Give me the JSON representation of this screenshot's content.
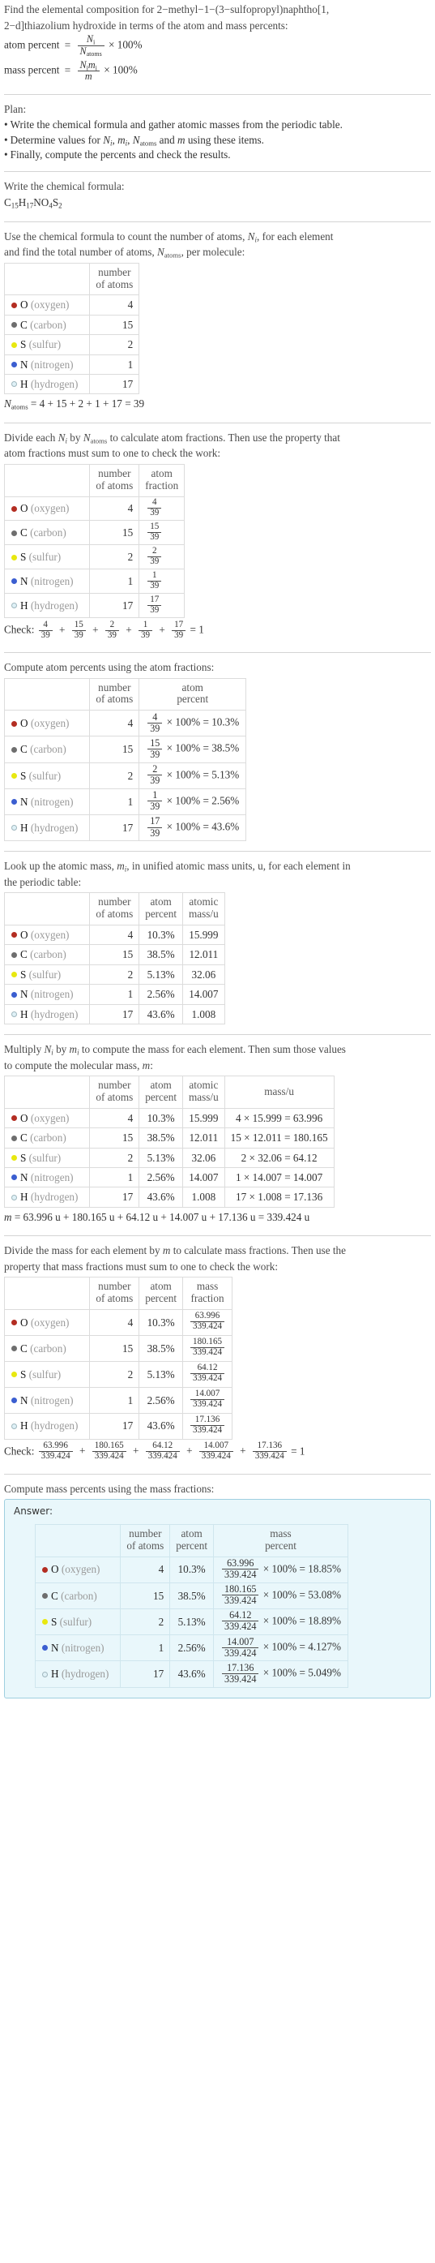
{
  "header": {
    "question_line1": "Find the elemental composition for 2−methyl−1−(3−sulfopropyl)naphtho[1,",
    "question_line2": "2−d]thiazolium hydroxide in terms of the atom and mass percents:",
    "atom_percent_label": "atom percent",
    "mass_percent_label": "mass percent",
    "percent_100": "× 100%",
    "equals": "=",
    "Ni": "N",
    "Ni_sub": "i",
    "Natoms": "N",
    "Natoms_sub": "atoms",
    "mi": "m",
    "mi_sub": "i",
    "m": "m"
  },
  "plan": {
    "title": "Plan:",
    "bullets": [
      "Write the chemical formula and gather atomic masses from the periodic table.",
      "Determine values for N_i, m_i, N_atoms and m using these items.",
      "Finally, compute the percents and check the results."
    ],
    "bullet1": "Write the chemical formula and gather atomic masses from the periodic table.",
    "bullet2_pre": "Determine values for",
    "bullet2_mid": "and",
    "bullet2_post": "using these items.",
    "bullet3": "Finally, compute the percents and check the results."
  },
  "formula_section": {
    "instruction": "Write the chemical formula:",
    "formula_parts": [
      {
        "sym": "C",
        "sub": "15"
      },
      {
        "sym": "H",
        "sub": "17"
      },
      {
        "sym": "N",
        "sub": ""
      },
      {
        "sym": "O",
        "sub": "4"
      },
      {
        "sym": "S",
        "sub": "2"
      }
    ],
    "formula_plain": "C15H17NO4S2"
  },
  "elements": [
    {
      "symbol": "O",
      "name": "(oxygen)",
      "color": "#b32d22",
      "hollow": false,
      "count": "4",
      "atom_fraction_num": "4",
      "atom_fraction_den": "39",
      "atom_percent": "10.3%",
      "atomic_mass": "15.999",
      "mass_expr": "4 × 15.999 = 63.996",
      "mass_product": "63.996",
      "mass_percent": "18.85%"
    },
    {
      "symbol": "C",
      "name": "(carbon)",
      "color": "#6e6e6e",
      "hollow": false,
      "count": "15",
      "atom_fraction_num": "15",
      "atom_fraction_den": "39",
      "atom_percent": "38.5%",
      "atomic_mass": "12.011",
      "mass_expr": "15 × 12.011 = 180.165",
      "mass_product": "180.165",
      "mass_percent": "53.08%"
    },
    {
      "symbol": "S",
      "name": "(sulfur)",
      "color": "#e8e80f",
      "hollow": false,
      "count": "2",
      "atom_fraction_num": "2",
      "atom_fraction_den": "39",
      "atom_percent": "5.13%",
      "atomic_mass": "32.06",
      "mass_expr": "2 × 32.06 = 64.12",
      "mass_product": "64.12",
      "mass_percent": "18.89%"
    },
    {
      "symbol": "N",
      "name": "(nitrogen)",
      "color": "#3b5ed0",
      "hollow": false,
      "count": "1",
      "atom_fraction_num": "1",
      "atom_fraction_den": "39",
      "atom_percent": "2.56%",
      "atomic_mass": "14.007",
      "mass_expr": "1 × 14.007 = 14.007",
      "mass_product": "14.007",
      "mass_percent": "4.127%"
    },
    {
      "symbol": "H",
      "name": "(hydrogen)",
      "color": "#dff1f7",
      "hollow": true,
      "count": "17",
      "atom_fraction_num": "17",
      "atom_fraction_den": "39",
      "atom_percent": "43.6%",
      "atomic_mass": "1.008",
      "mass_expr": "17 × 1.008 = 17.136",
      "mass_product": "17.136",
      "mass_percent": "5.049%"
    }
  ],
  "count_section": {
    "instruction_line1": "Use the chemical formula to count the number of atoms, N_i, for each element",
    "instruction_line2": "and find the total number of atoms, N_atoms, per molecule:",
    "col_number_of_atoms_l1": "number",
    "col_number_of_atoms_l2": "of atoms",
    "total_expr": "= 4 + 15 + 2 + 1 + 17 = 39",
    "total_value": "39"
  },
  "fraction_section": {
    "instruction_line1": "Divide each N_i by N_atoms to calculate atom fractions. Then use the property that",
    "instruction_line2": "atom fractions must sum to one to check the work:",
    "col_atom_fraction_l1": "atom",
    "col_atom_fraction_l2": "fraction",
    "check_label": "Check:",
    "check_result": "= 1",
    "denominator": "39"
  },
  "atom_percent_section": {
    "instruction": "Compute atom percents using the atom fractions:",
    "col_atom_percent_l1": "atom",
    "col_atom_percent_l2": "percent",
    "times100": "× 100% ="
  },
  "atomic_mass_section": {
    "instruction_line1": "Look up the atomic mass, m_i, in unified atomic mass units, u, for each element in",
    "instruction_line2": "the periodic table:",
    "col_atomic_mass_l1": "atomic",
    "col_atomic_mass_l2": "mass/u"
  },
  "multiply_section": {
    "instruction_line1": "Multiply N_i by m_i to compute the mass for each element. Then sum those values",
    "instruction_line2": "to compute the molecular mass, m:",
    "col_mass_u": "mass/u",
    "total_expr": "= 63.996 u + 180.165 u + 64.12 u + 14.007 u + 17.136 u = 339.424 u",
    "total_value": "339.424 u"
  },
  "mass_fraction_section": {
    "instruction_line1": "Divide the mass for each element by m to calculate mass fractions. Then use the",
    "instruction_line2": "property that mass fractions must sum to one to check the work:",
    "col_mass_fraction_l1": "mass",
    "col_mass_fraction_l2": "fraction",
    "check_label": "Check:",
    "check_result": "= 1",
    "denominator": "339.424"
  },
  "mass_percent_section": {
    "instruction": "Compute mass percents using the mass fractions:",
    "answer_label": "Answer:",
    "col_mass_percent_l1": "mass",
    "col_mass_percent_l2": "percent",
    "times100": "× 100% =",
    "denominator": "339.424"
  }
}
